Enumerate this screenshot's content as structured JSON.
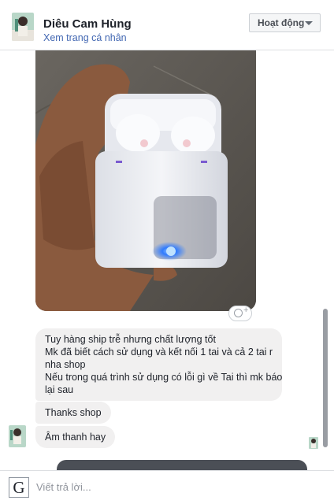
{
  "header": {
    "name": "Diêu Cam Hùng",
    "profile_link": "Xem trang cá nhân",
    "status_button": "Hoạt động"
  },
  "messages": [
    {
      "lines": [
        "Tuy hàng ship trễ nhưng chất lượng tốt",
        "Mk đã biết cách sử dụng và kết nối 1 tai và cả 2 tai r",
        "nha shop",
        "Nếu trong quá trình sử dụng có lỗi gì về Tai thì mk báo",
        "lại sau"
      ]
    },
    {
      "text": "Thanks shop"
    },
    {
      "text": "Âm thanh hay"
    }
  ],
  "composer": {
    "icon_letter": "G",
    "placeholder": "Viết trả lời..."
  },
  "icons": {
    "reaction": "add-reaction-icon",
    "dropdown": "chevron-down-icon",
    "input_tool": "google-input-tools-icon"
  },
  "colors": {
    "link": "#4267b2",
    "bubble": "#f1f0f0",
    "led": "#2f7bff"
  }
}
